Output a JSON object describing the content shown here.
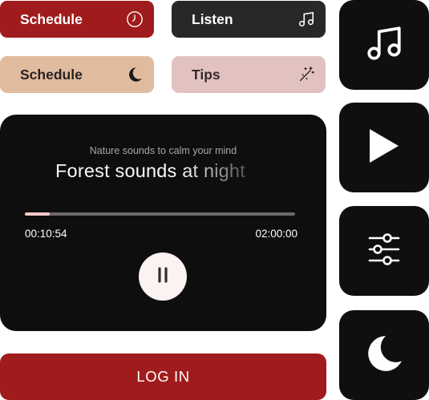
{
  "chips": {
    "schedule_primary": {
      "label": "Schedule",
      "icon": "clock-icon"
    },
    "listen": {
      "label": "Listen",
      "icon": "music-note-icon"
    },
    "schedule_secondary": {
      "label": "Schedule",
      "icon": "moon-icon"
    },
    "tips": {
      "label": "Tips",
      "icon": "magic-wand-icon"
    }
  },
  "tiles": [
    {
      "icon": "music-note-icon"
    },
    {
      "icon": "play-icon"
    },
    {
      "icon": "sliders-icon"
    },
    {
      "icon": "moon-icon"
    }
  ],
  "player": {
    "subtitle": "Nature sounds to calm your mind",
    "title": "Forest sounds at night",
    "elapsed": "00:10:54",
    "total": "02:00:00",
    "progress_fraction": 0.0908
  },
  "login": {
    "label": "LOG IN"
  },
  "colors": {
    "brand_red": "#a01c1c",
    "dark": "#0f0f0f",
    "tan": "#e0bb9d",
    "pink": "#e2c2c1",
    "progress": "#f1c9c8"
  }
}
